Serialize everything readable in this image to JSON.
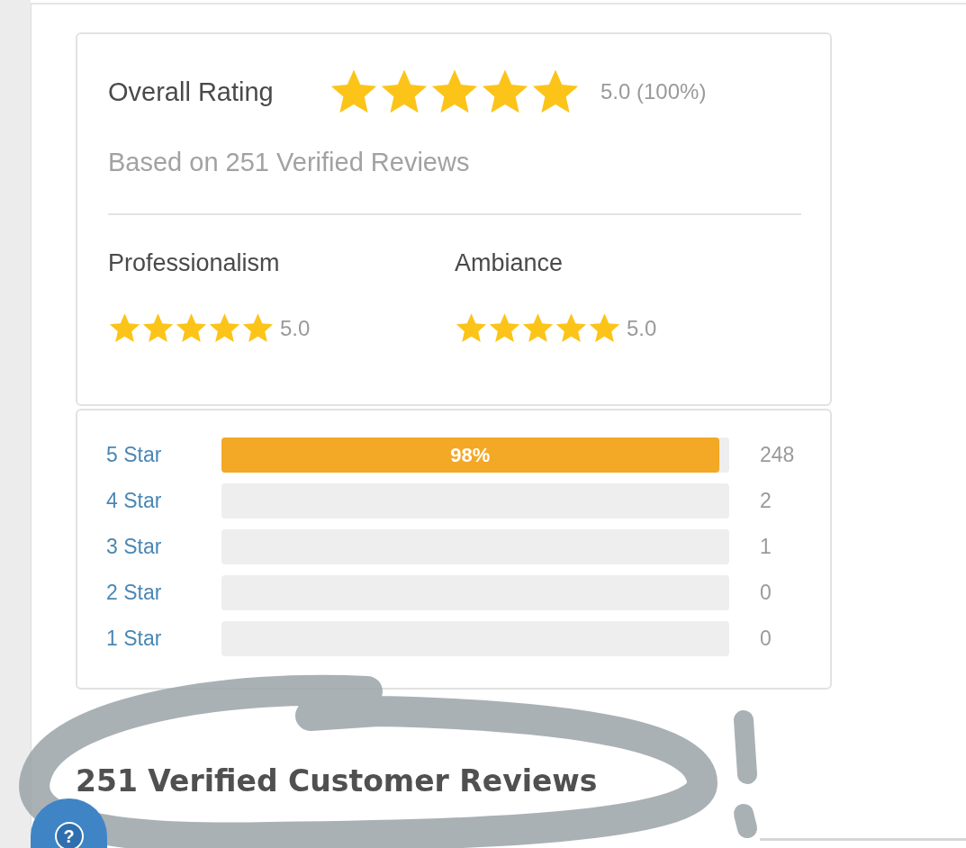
{
  "overall": {
    "label": "Overall Rating",
    "stars": 5,
    "score": "5.0 (100%)",
    "based_on": "Based on 251 Verified Reviews"
  },
  "categories": [
    {
      "label": "Professionalism",
      "stars": 5,
      "score": "5.0"
    },
    {
      "label": "Ambiance",
      "stars": 5,
      "score": "5.0"
    }
  ],
  "distribution": [
    {
      "label": "5 Star",
      "level": 0.98,
      "percent": "98%",
      "count": "248"
    },
    {
      "label": "4 Star",
      "count": "2"
    },
    {
      "label": "3 Star",
      "count": "1"
    },
    {
      "label": "2 Star",
      "count": "0"
    },
    {
      "label": "1 Star",
      "count": "0"
    }
  ],
  "reviews_heading": "251 Verified Customer Reviews",
  "help_button": {
    "label": "?"
  }
}
